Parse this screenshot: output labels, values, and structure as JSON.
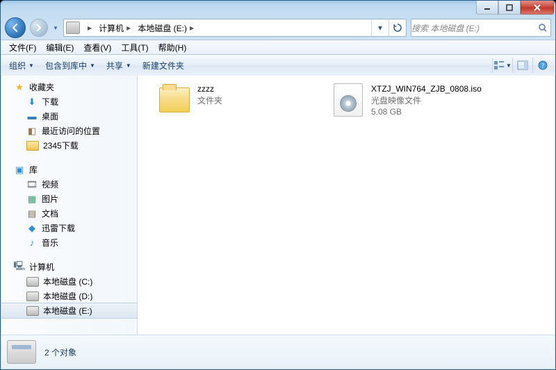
{
  "titlebar": {},
  "nav": {
    "breadcrumbs": [
      "计算机",
      "本地磁盘 (E:)"
    ]
  },
  "search": {
    "placeholder": "搜索 本地磁盘 (E:)"
  },
  "menu": {
    "file": "文件(F)",
    "edit": "编辑(E)",
    "view": "查看(V)",
    "tools": "工具(T)",
    "help": "帮助(H)"
  },
  "toolbar": {
    "organize": "组织",
    "include": "包含到库中",
    "share": "共享",
    "newfolder": "新建文件夹"
  },
  "sidebar": {
    "favorites": {
      "label": "收藏夹",
      "items": [
        "下载",
        "桌面",
        "最近访问的位置",
        "2345下载"
      ]
    },
    "libraries": {
      "label": "库",
      "items": [
        "视频",
        "图片",
        "文档",
        "迅雷下载",
        "音乐"
      ]
    },
    "computer": {
      "label": "计算机",
      "items": [
        "本地磁盘 (C:)",
        "本地磁盘 (D:)",
        "本地磁盘 (E:)"
      ]
    }
  },
  "files": {
    "folder": {
      "name": "zzzz",
      "type": "文件夹"
    },
    "iso": {
      "name": "XTZJ_WIN764_ZJB_0808.iso",
      "type": "光盘映像文件",
      "size": "5.08 GB"
    }
  },
  "details": {
    "text": "2 个对象"
  }
}
